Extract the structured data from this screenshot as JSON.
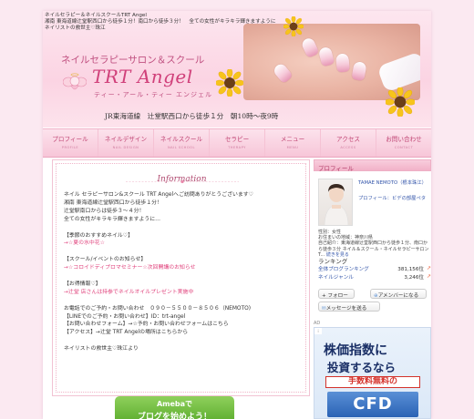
{
  "header": {
    "top_lines": [
      "ネイルセラピー＆ネイルスクールTRT Angel",
      "湘南 東海道線辻堂駅西口から徒歩１分！南口から徒歩３分！　全ての女性がキラキラ輝きますように",
      "ネイリストの救世主♡珠江"
    ],
    "tagline": "ネイルセラピーサロン＆スクール",
    "logo": "TRT Angel",
    "logo_reading": "ティー・アール・ティー エンジェル",
    "location": "JR東海道線　辻堂駅西口から徒歩１分　朝10時〜夜9時"
  },
  "nav": [
    {
      "jp": "プロフィール",
      "en": "PROFILE"
    },
    {
      "jp": "ネイルデザイン",
      "en": "NAIL DESIGN"
    },
    {
      "jp": "ネイルスクール",
      "en": "NAIL SCHOOL"
    },
    {
      "jp": "セラピー",
      "en": "THERAPY"
    },
    {
      "jp": "メニュー",
      "en": "MENU"
    },
    {
      "jp": "アクセス",
      "en": "ACCESS"
    },
    {
      "jp": "お問い合わせ",
      "en": "CONTACT"
    }
  ],
  "info": {
    "title": "Information",
    "lines": [
      {
        "text": "ネイル セラピーサロン&スクール TRT Angelへご訪問ありがとうございます♡",
        "pink": false
      },
      {
        "text": "湘南 東海道線辻堂駅西口から徒歩１分！",
        "pink": false
      },
      {
        "text": "辻堂駅南口からは徒歩３～４分！",
        "pink": false
      },
      {
        "text": "全ての女性がキラキラ輝きますように…",
        "pink": false
      },
      {
        "text": "",
        "pink": false
      },
      {
        "text": "【季節のおすすめネイル♡】",
        "pink": false
      },
      {
        "text": "→☆夏の水中花☆",
        "pink": true
      },
      {
        "text": "",
        "pink": false
      },
      {
        "text": "【スクール/イベントのお知らせ】",
        "pink": false
      },
      {
        "text": "→☆コロイドディプロマセミナー☆次回開講のお知らせ",
        "pink": true
      },
      {
        "text": "",
        "pink": false
      },
      {
        "text": "【お得情報♡】",
        "pink": false
      },
      {
        "text": "→辻堂 店さんは持参でネイルオイルプレゼント実施中",
        "pink": true
      },
      {
        "text": "",
        "pink": false
      },
      {
        "text": "お電話でのご予約・お問い合わせ　０９０－５５００－８５０６（NEMOTO)",
        "pink": false
      },
      {
        "text": "【LINEでのご予約・お問い合わせ】ID：trt-angel",
        "pink": false
      },
      {
        "text": "【お問い合わせフォーム】→☆予約・お問い合わせフォームはこちら",
        "pink": false
      },
      {
        "text": "【アクセス】→辻堂 TRT Angelの場所はこちらから",
        "pink": false
      },
      {
        "text": "",
        "pink": false
      },
      {
        "text": "ネイリストの救世主♡珠江より",
        "pink": false
      }
    ]
  },
  "ameba": {
    "line1": "Amebaで",
    "line2": "ブログを始めよう！"
  },
  "sidebar": {
    "header": "プロフィール",
    "name": "TAMAE NEMOTO（根本珠江）",
    "genre": "プロフィール：ビデの部屋ペタ",
    "details": [
      "性別：女性",
      "お住まいの地域：神奈川県",
      "自己紹介：東海道線辻堂駅西口から徒歩１分、南口から徒歩３分 ネイル＆スクール・ネイルセラピーサロン T..."
    ],
    "more": "続きを見る",
    "ranking_title": "ランキング",
    "rankings": [
      {
        "label": "全体ブログランキング",
        "value": "381,156位"
      },
      {
        "label": "ネイルジャンル",
        "value": "3,246位"
      }
    ],
    "follow": "+ フォロー",
    "amember": "アメンバーになる",
    "message": "メッセージを送る",
    "ad_label": "AD"
  },
  "ad": {
    "line1": "株価指数に",
    "line2": "投資するなら",
    "line3": "手数料無料の",
    "line4": "CFD"
  }
}
